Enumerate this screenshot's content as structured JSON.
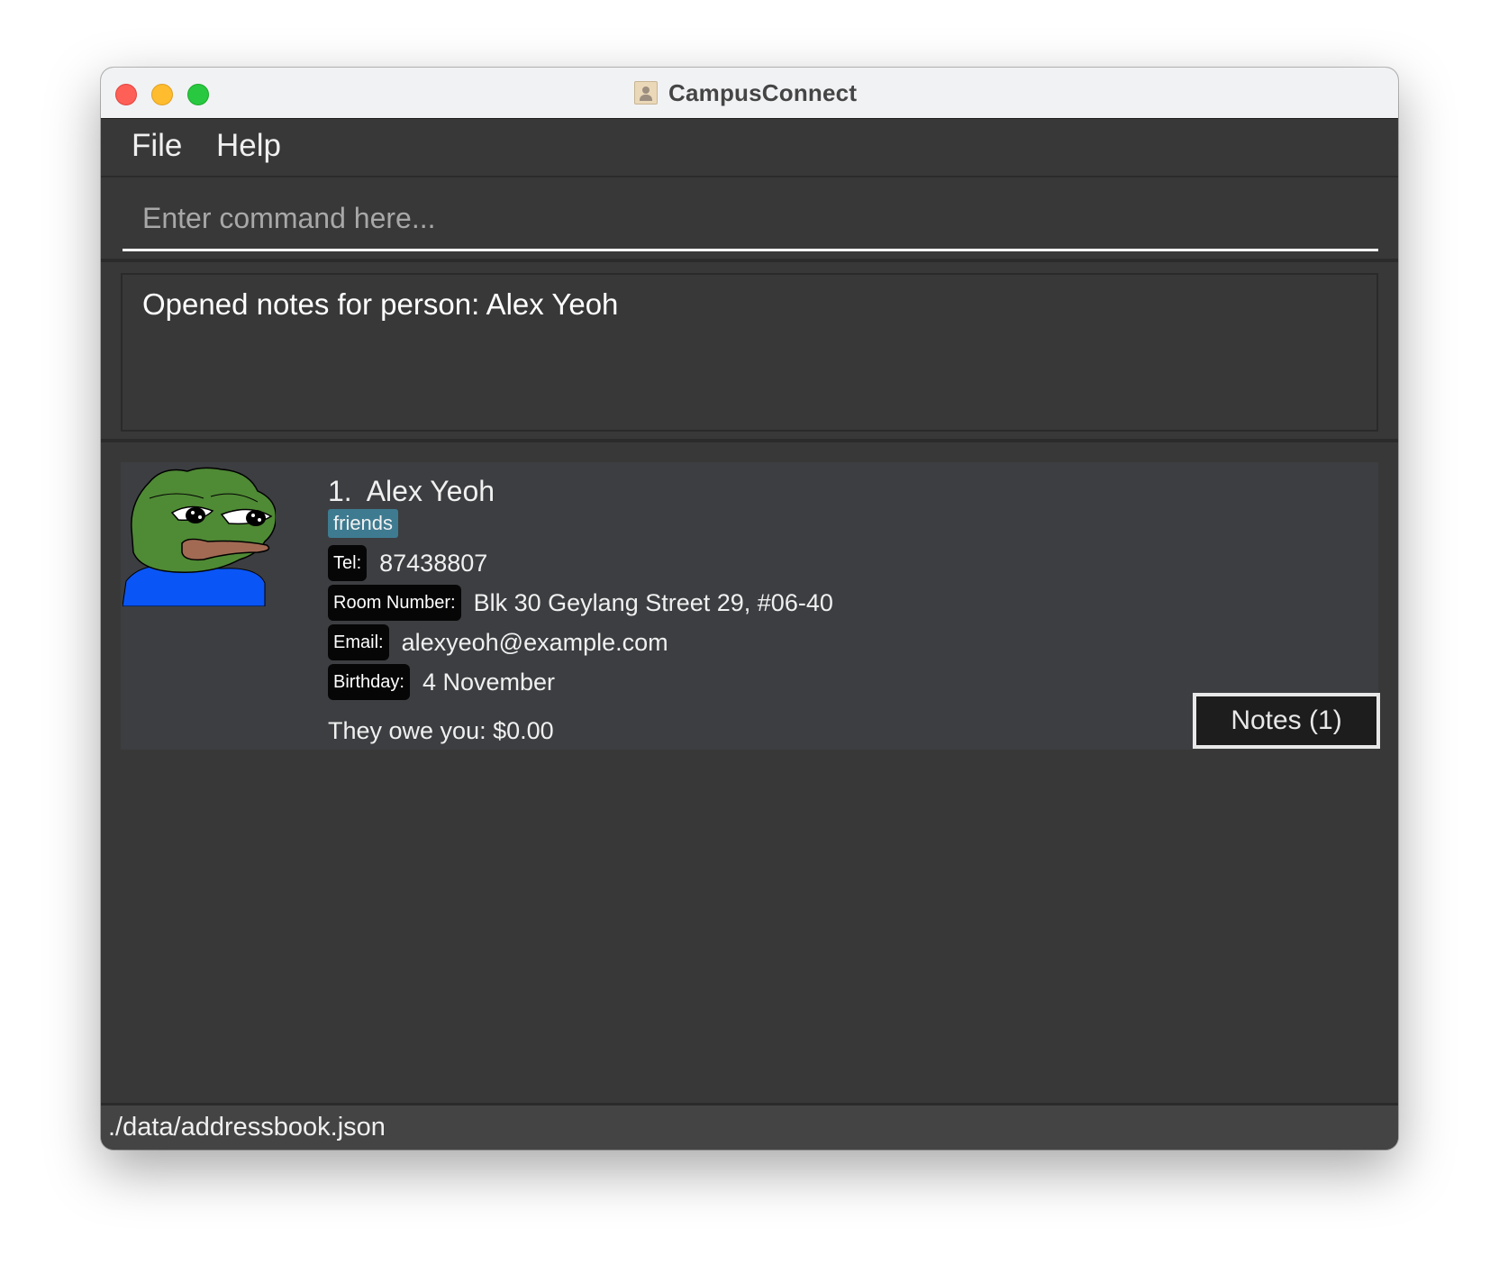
{
  "window": {
    "title": "CampusConnect",
    "title_icon": "address-book-icon"
  },
  "menu": {
    "items": [
      {
        "label": "File"
      },
      {
        "label": "Help"
      }
    ]
  },
  "command": {
    "placeholder": "Enter command here...",
    "value": ""
  },
  "result": {
    "message": "Opened notes for person: Alex Yeoh"
  },
  "people": [
    {
      "index_label": "1.  Alex Yeoh",
      "index": "1.",
      "name": "Alex Yeoh",
      "avatar": "frog-avatar",
      "tags": [
        "friends"
      ],
      "fields": [
        {
          "label": "Tel:",
          "value": "87438807"
        },
        {
          "label": "Room Number:",
          "value": "Blk 30 Geylang Street 29, #06-40"
        },
        {
          "label": "Email:",
          "value": "alexyeoh@example.com"
        },
        {
          "label": "Birthday:",
          "value": "4 November"
        }
      ],
      "owe": "They owe you: $0.00",
      "notes_button": "Notes (1)"
    }
  ],
  "status": {
    "file_path": "./data/addressbook.json"
  },
  "colors": {
    "tag": "#3e7b91",
    "card_bg": "#3c3e41",
    "window_bg": "#383838",
    "label_bg": "#060606"
  }
}
